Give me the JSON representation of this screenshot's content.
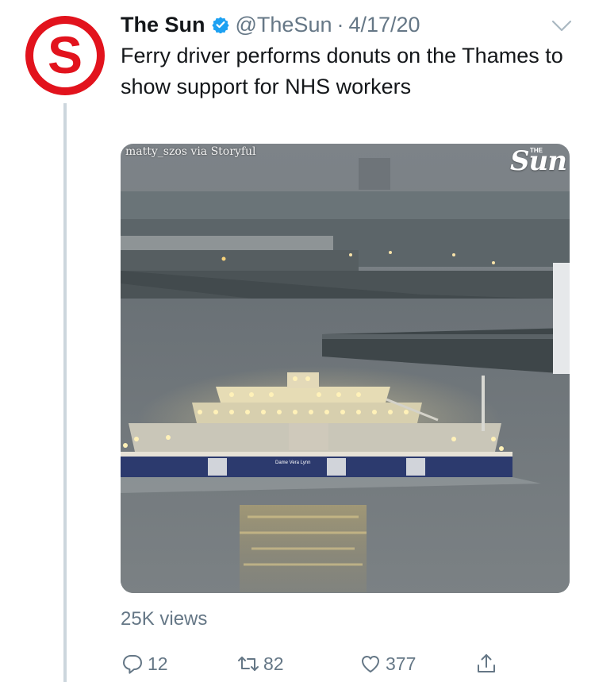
{
  "tweet": {
    "author": {
      "display_name": "The Sun",
      "handle": "@TheSun",
      "avatar_letter": "S",
      "verified": true
    },
    "separator": "·",
    "date": "4/17/20",
    "text": "Ferry driver performs donuts on the Thames to show support for NHS workers",
    "media": {
      "credit": "matty_szos via Storyful",
      "watermark": "Sun",
      "watermark_small": "THE",
      "hull_name": "Dame Vera Lynn"
    },
    "views": "25K views",
    "actions": {
      "reply_count": "12",
      "retweet_count": "82",
      "like_count": "377"
    }
  },
  "colors": {
    "brand_red": "#e2131d",
    "verified_blue": "#1da1f2",
    "text_primary": "#14171a",
    "text_secondary": "#657786",
    "thread_line": "#ccd6dd"
  },
  "icons": [
    "verified-icon",
    "caret-down-icon",
    "reply-icon",
    "retweet-icon",
    "like-icon",
    "share-icon"
  ]
}
